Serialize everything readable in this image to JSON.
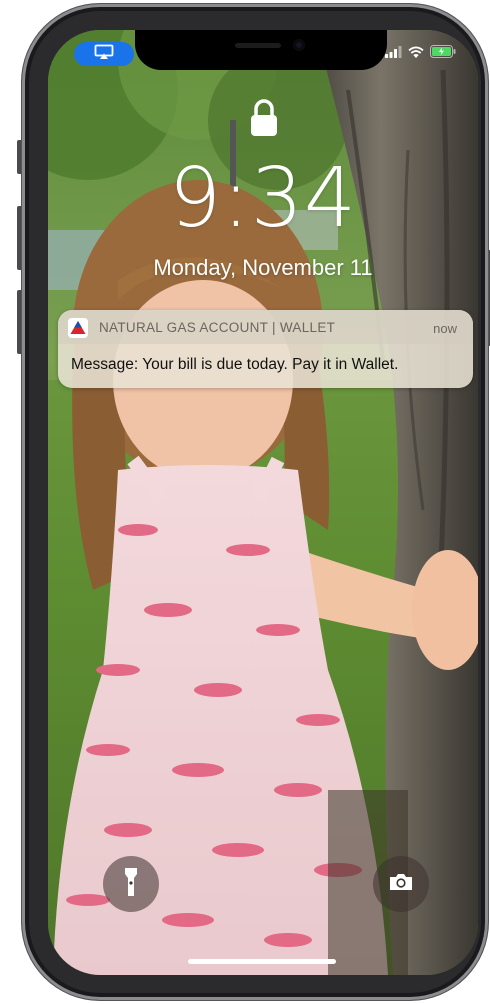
{
  "status_bar": {
    "airplay_icon": "airplay-icon",
    "signal_icon": "cellular-signal-icon",
    "wifi_icon": "wifi-icon",
    "battery_icon": "battery-charging-icon",
    "airplay_color": "#1a73e8"
  },
  "lock_screen": {
    "lock_icon": "padlock-icon",
    "time": "9:34",
    "date": "Monday, November 11"
  },
  "notification": {
    "app_icon": "natural-gas-logo-icon",
    "app_name": "NATURAL GAS ACCOUNT | WALLET",
    "time": "now",
    "body": "Message: Your bill is due today. Pay it in Wallet."
  },
  "controls": {
    "flashlight_icon": "flashlight-icon",
    "camera_icon": "camera-icon"
  }
}
